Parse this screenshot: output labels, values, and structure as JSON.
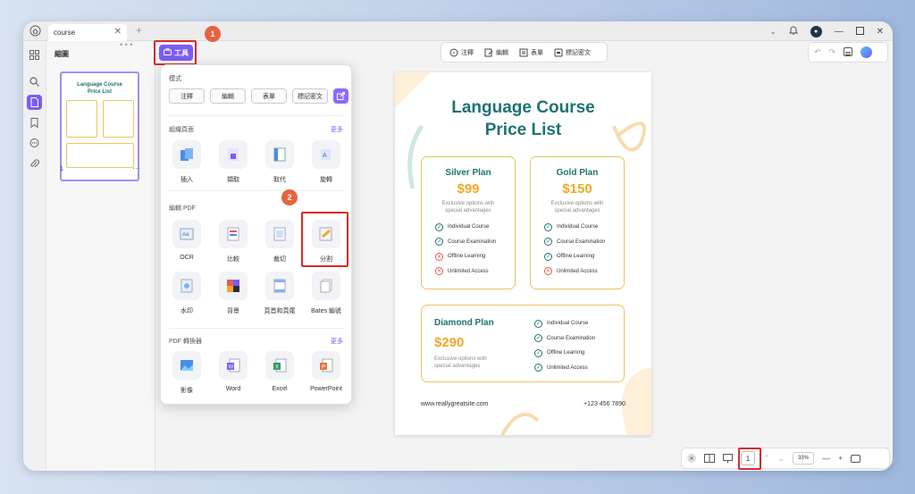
{
  "tab": {
    "title": "course"
  },
  "panel": {
    "title": "縮圖",
    "page_label": "1"
  },
  "toolbar": {
    "tools_label": "工具",
    "comment": "注釋",
    "edit": "編輯",
    "form": "表單",
    "redact": "標記密文"
  },
  "popup": {
    "mode_label": "模式",
    "modes": [
      "注釋",
      "編輯",
      "表單",
      "標記密文"
    ],
    "organize_label": "組織頁面",
    "organize_more": "更多",
    "organize_tools": [
      "插入",
      "擷取",
      "取代",
      "旋轉"
    ],
    "edit_label": "編輯 PDF",
    "edit_tools_row1": [
      "OCR",
      "比較",
      "裁切",
      "分割"
    ],
    "edit_tools_row2": [
      "水印",
      "背景",
      "頁首和頁尾",
      "Bates 編號"
    ],
    "convert_label": "PDF 轉換器",
    "convert_more": "更多",
    "convert_tools": [
      "影像",
      "Word",
      "Excel",
      "PowerPoint"
    ]
  },
  "annotations": {
    "badge1": "1",
    "badge2": "2"
  },
  "doc": {
    "title_line1": "Language Course",
    "title_line2": "Price List",
    "silver": {
      "name": "Silver Plan",
      "price": "$99",
      "desc1": "Exclusive options with",
      "desc2": "special advantages",
      "features": [
        {
          "text": "Individual Course",
          "ok": true
        },
        {
          "text": "Course Examination",
          "ok": true
        },
        {
          "text": "Offline Learning",
          "ok": false
        },
        {
          "text": "Unlimited Access",
          "ok": false
        }
      ]
    },
    "gold": {
      "name": "Gold Plan",
      "price": "$150",
      "desc1": "Exclusive options with",
      "desc2": "special advantages",
      "features": [
        {
          "text": "Individual Course",
          "ok": true
        },
        {
          "text": "Course Examination",
          "ok": true
        },
        {
          "text": "Offline Learning",
          "ok": true
        },
        {
          "text": "Unlimited Access",
          "ok": false
        }
      ]
    },
    "diamond": {
      "name": "Diamond Plan",
      "price": "$290",
      "desc1": "Exclusive options with",
      "desc2": "special advantages",
      "features": [
        {
          "text": "Individual Course",
          "ok": true
        },
        {
          "text": "Course Examination",
          "ok": true
        },
        {
          "text": "Offline Learning",
          "ok": true
        },
        {
          "text": "Unlimited Access",
          "ok": true
        }
      ]
    },
    "website": "www.reallygreatsite.com",
    "phone": "+123 456 7890"
  },
  "status": {
    "page": "1",
    "zoom": "33%"
  },
  "colors": {
    "accent": "#7b5cf5",
    "teal": "#1f7272",
    "gold": "#f0a928",
    "highlight": "#d62b2b"
  }
}
